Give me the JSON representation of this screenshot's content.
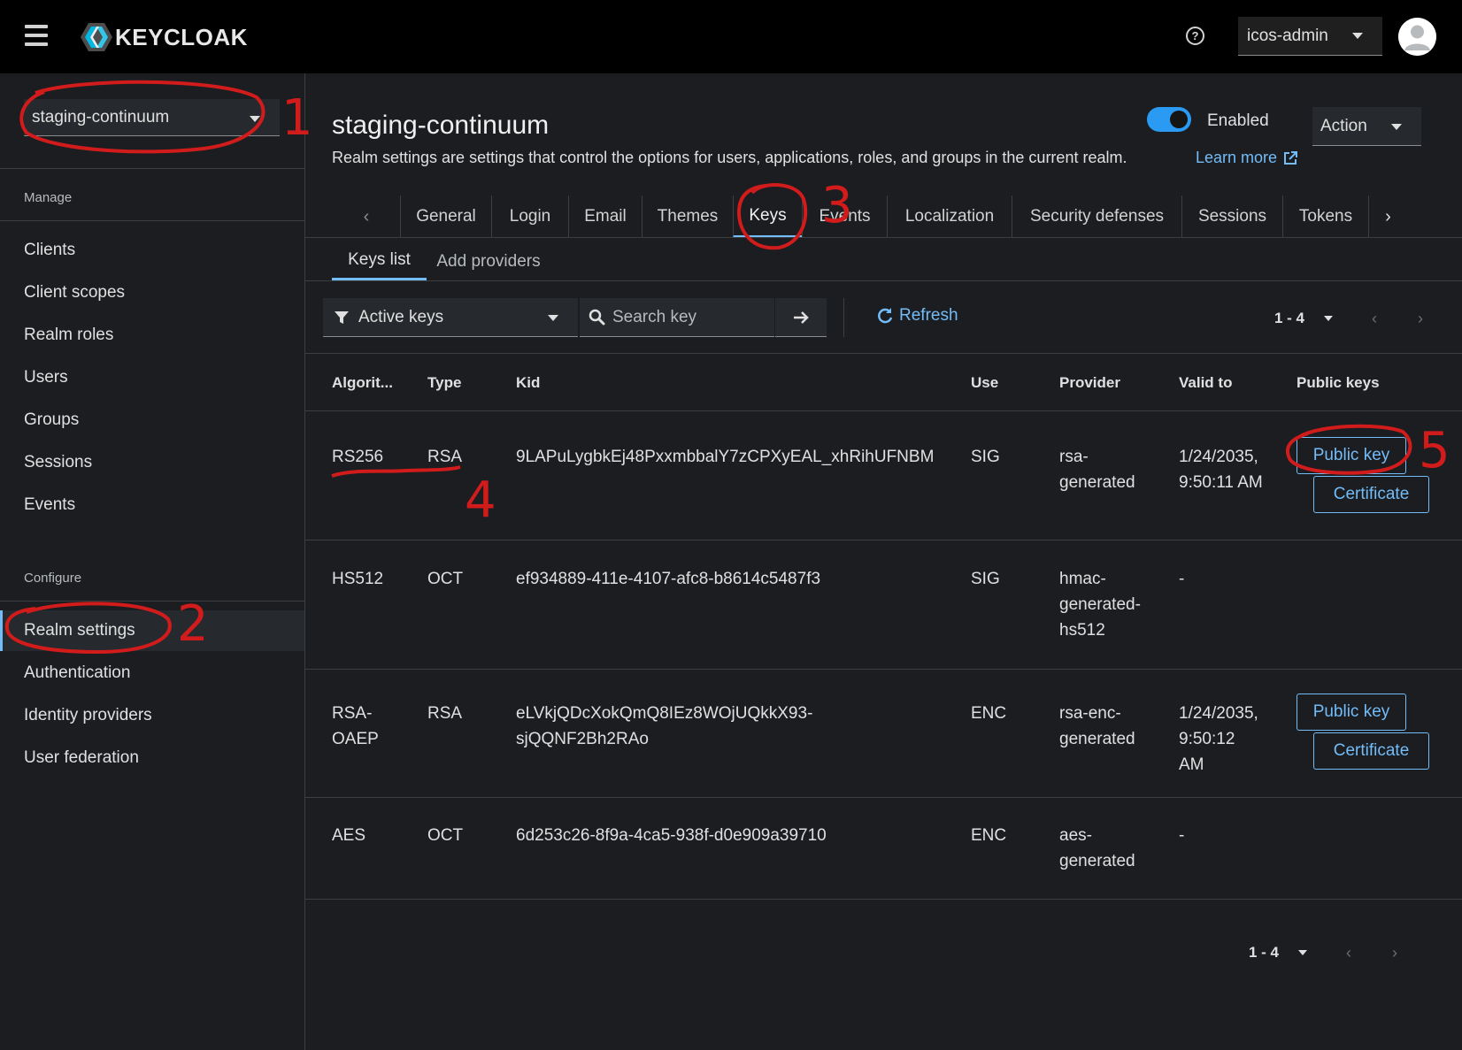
{
  "masthead": {
    "logo_text": "KEYCLOAK",
    "help_icon": "?",
    "user_name": "icos-admin"
  },
  "sidebar": {
    "realm": "staging-continuum",
    "manage_label": "Manage",
    "manage_items": [
      "Clients",
      "Client scopes",
      "Realm roles",
      "Users",
      "Groups",
      "Sessions",
      "Events"
    ],
    "configure_label": "Configure",
    "configure_items": [
      "Realm settings",
      "Authentication",
      "Identity providers",
      "User federation"
    ]
  },
  "header": {
    "title": "staging-continuum",
    "description": "Realm settings are settings that control the options for users, applications, roles, and groups in the current realm.",
    "learn_more": "Learn more",
    "enabled_label": "Enabled",
    "enabled": true,
    "action_label": "Action"
  },
  "tabs": [
    "General",
    "Login",
    "Email",
    "Themes",
    "Keys",
    "Events",
    "Localization",
    "Security defenses",
    "Sessions",
    "Tokens"
  ],
  "active_tab": "Keys",
  "subtabs": [
    "Keys list",
    "Add providers"
  ],
  "active_subtab": "Keys list",
  "toolbar": {
    "filter_label": "Active keys",
    "search_placeholder": "Search key",
    "refresh_label": "Refresh",
    "pagination": "1 - 4"
  },
  "table": {
    "columns": [
      "Algorit...",
      "Type",
      "Kid",
      "Use",
      "Provider",
      "Valid to",
      "Public keys"
    ],
    "rows": [
      {
        "algorithm": "RS256",
        "type": "RSA",
        "kid": "9LAPuLygbkEj48PxxmbbalY7zCPXyEAL_xhRihUFNBM",
        "use": "SIG",
        "provider": "rsa-\ngenerated",
        "valid_to": "1/24/2035,\n9:50:11 AM",
        "public_key_label": "Public key",
        "certificate_label": "Certificate"
      },
      {
        "algorithm": "HS512",
        "type": "OCT",
        "kid": "ef934889-411e-4107-afc8-b8614c5487f3",
        "use": "SIG",
        "provider": "hmac-\ngenerated-\nhs512",
        "valid_to": "-"
      },
      {
        "algorithm": "RSA-\nOAEP",
        "type": "RSA",
        "kid": "eLVkjQDcXokQmQ8IEz8WOjUQkkX93-\nsjQQNF2Bh2RAo",
        "use": "ENC",
        "provider": "rsa-enc-\ngenerated",
        "valid_to": "1/24/2035,\n9:50:12\nAM",
        "public_key_label": "Public key",
        "certificate_label": "Certificate"
      },
      {
        "algorithm": "AES",
        "type": "OCT",
        "kid": "6d253c26-8f9a-4ca5-938f-d0e909a39710",
        "use": "ENC",
        "provider": "aes-\ngenerated",
        "valid_to": "-"
      }
    ]
  },
  "footer_pagination": "1 - 4",
  "annotations": [
    "1",
    "2",
    "3",
    "4",
    "5"
  ],
  "colors": {
    "accent": "#73bcf7",
    "annotation_red": "#d21c1c",
    "toggle_on": "#2b9af3"
  }
}
